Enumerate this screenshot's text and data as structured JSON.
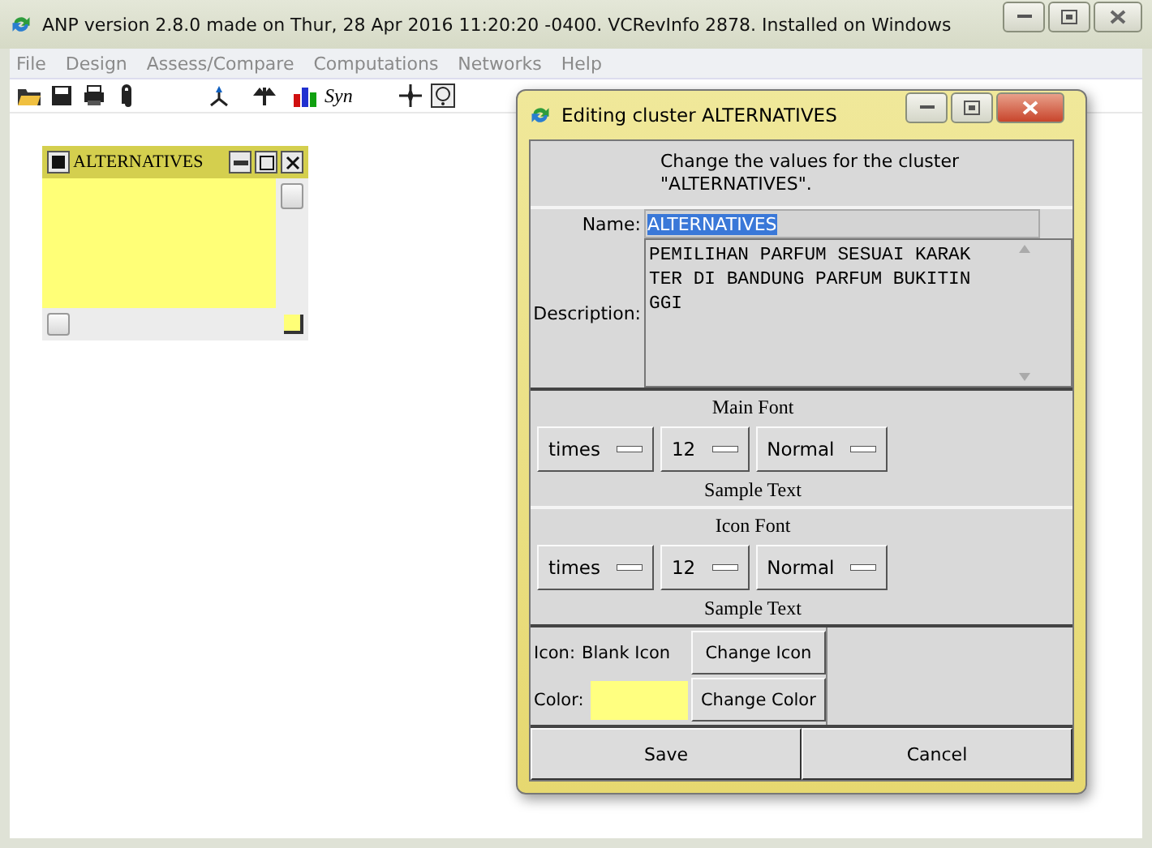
{
  "window": {
    "title": "ANP version 2.8.0 made on Thur, 28 Apr 2016 11:20:20 -0400.  VCRevInfo 2878.  Installed on Windows"
  },
  "menu": [
    {
      "label": "File",
      "disabled": true
    },
    {
      "label": "Design",
      "disabled": true
    },
    {
      "label": "Assess/Compare",
      "disabled": true
    },
    {
      "label": "Computations",
      "disabled": true
    },
    {
      "label": "Networks",
      "disabled": true
    },
    {
      "label": "Help",
      "disabled": true
    }
  ],
  "toolbar": {
    "syn_label": "Syn"
  },
  "cluster_window": {
    "title": "ALTERNATIVES",
    "color": "#ffff77"
  },
  "dialog": {
    "title": "Editing cluster ALTERNATIVES",
    "instruction": "Change the values for the cluster \"ALTERNATIVES\".",
    "name": {
      "label": "Name:",
      "value": "ALTERNATIVES",
      "selected": true
    },
    "description": {
      "label": "Description:",
      "value": "PEMILIHAN PARFUM SESUAI KARAKTER DI BANDUNG PARFUM BUKITINGGI"
    },
    "font_sections": [
      {
        "heading": "Main Font",
        "family": "times",
        "size": "12",
        "style": "Normal",
        "sample": "Sample Text"
      },
      {
        "heading": "Icon Font",
        "family": "times",
        "size": "12",
        "style": "Normal",
        "sample": "Sample Text"
      }
    ],
    "icon": {
      "label": "Icon:",
      "value": "Blank Icon",
      "button": "Change Icon"
    },
    "color": {
      "label": "Color:",
      "color": "#ffff80",
      "button": "Change Color"
    },
    "buttons": [
      "Save",
      "Cancel"
    ]
  }
}
